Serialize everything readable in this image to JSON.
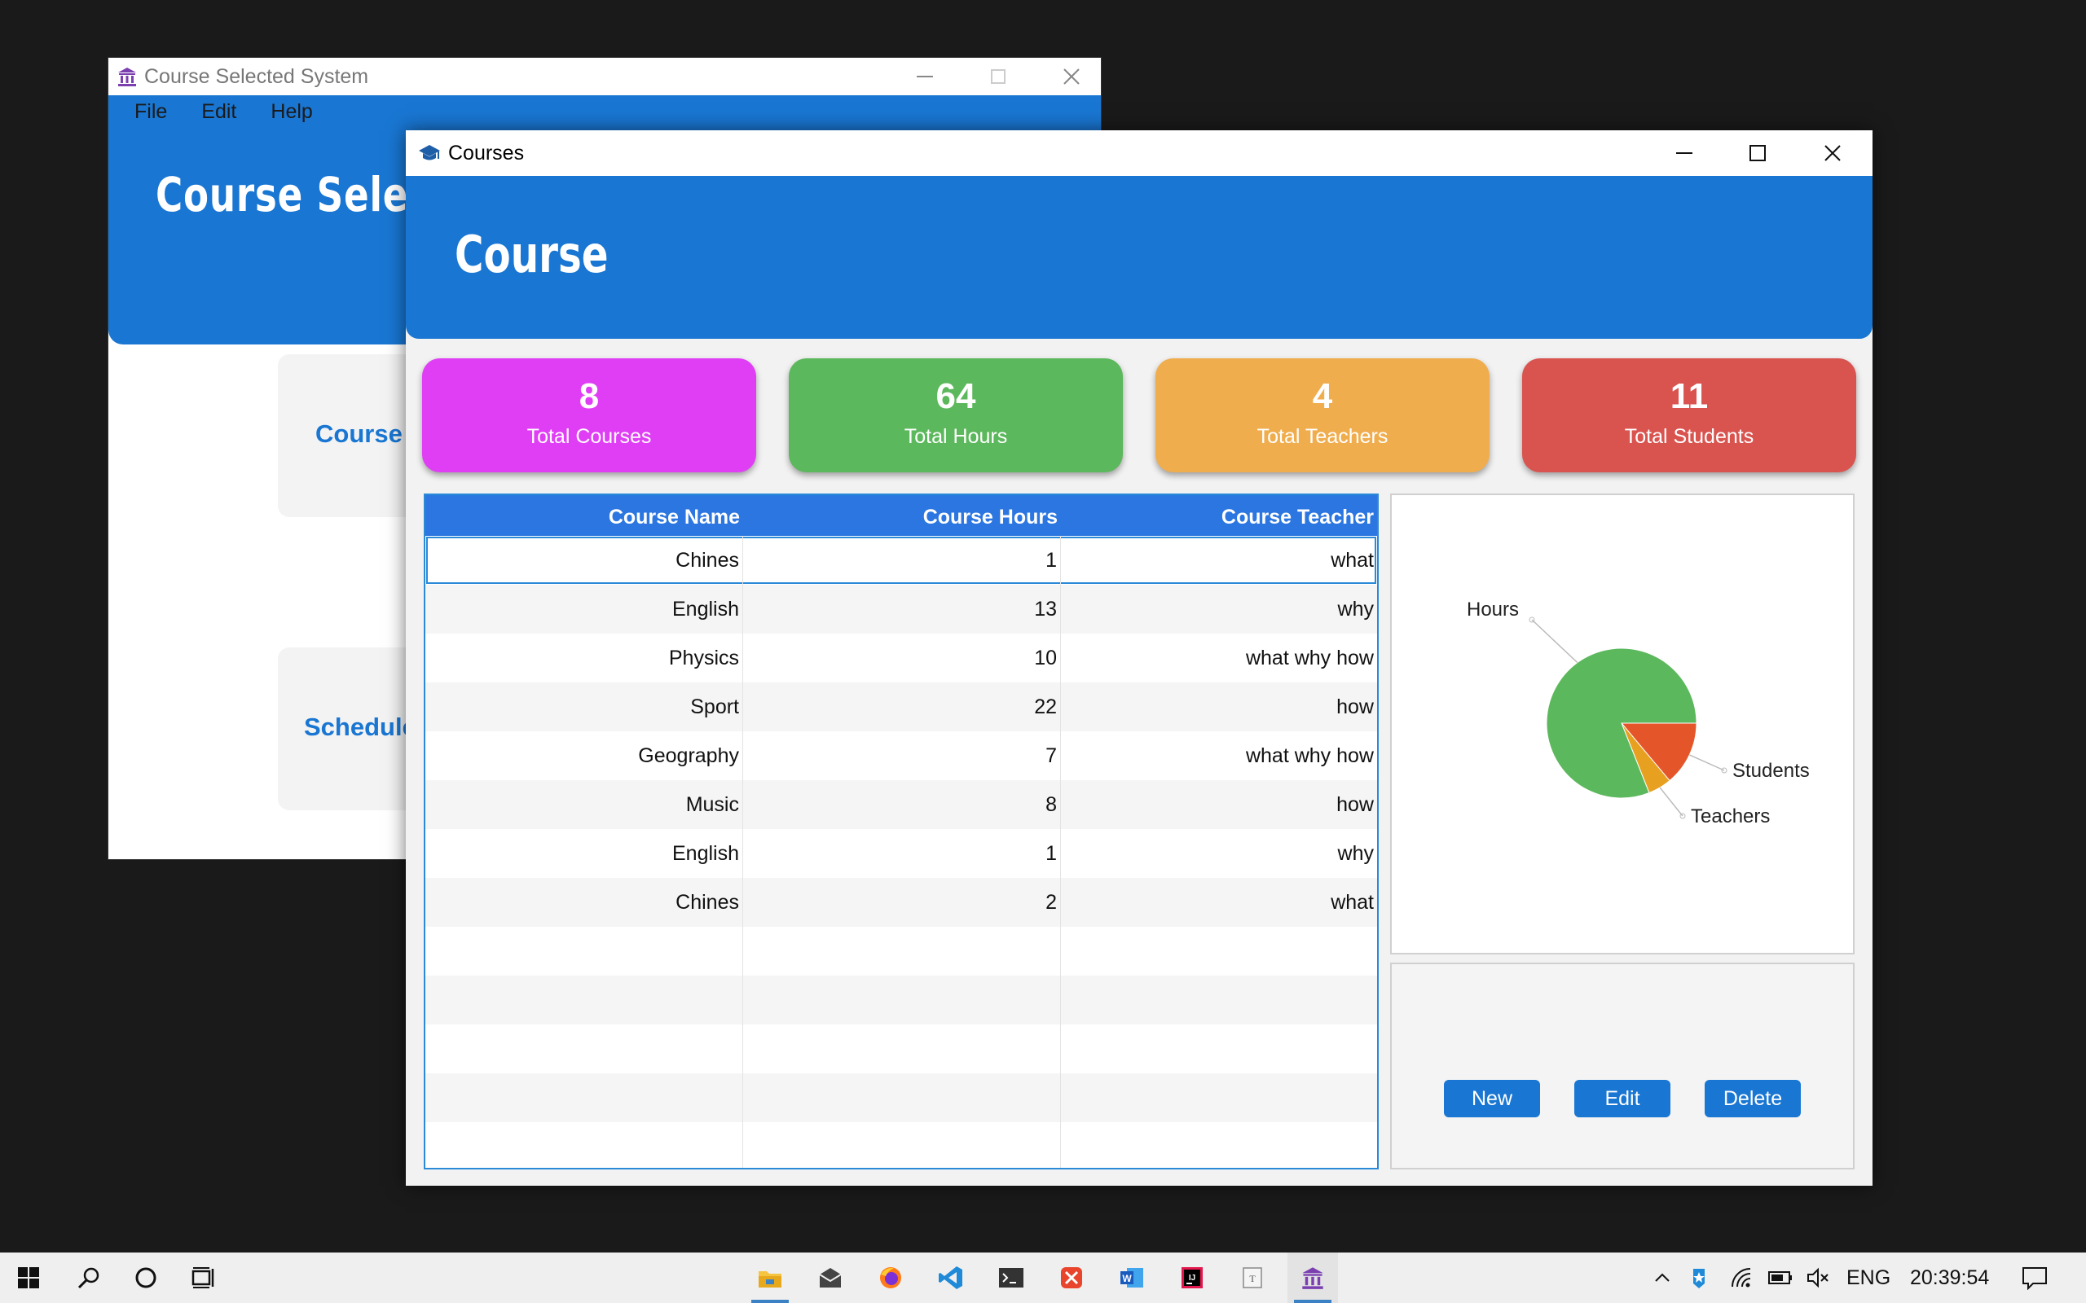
{
  "bg_window": {
    "title": "Course Selected System",
    "menu": [
      "File",
      "Edit",
      "Help"
    ],
    "header_title": "Course Selecte",
    "tiles": [
      "Course",
      "Schedule"
    ]
  },
  "fg_window": {
    "title": "Courses",
    "header_title": "Course"
  },
  "stats": [
    {
      "value": "8",
      "label": "Total Courses",
      "color": "#e03ef5"
    },
    {
      "value": "64",
      "label": "Total Hours",
      "color": "#5cb85c"
    },
    {
      "value": "4",
      "label": "Total Teachers",
      "color": "#f0ad4e"
    },
    {
      "value": "11",
      "label": "Total Students",
      "color": "#d9534f"
    }
  ],
  "table": {
    "headers": [
      "Course Name",
      "Course Hours",
      "Course Teacher"
    ],
    "rows": [
      [
        "Chines",
        "1",
        "what"
      ],
      [
        "English",
        "13",
        "why"
      ],
      [
        "Physics",
        "10",
        "what why how"
      ],
      [
        "Sport",
        "22",
        "how"
      ],
      [
        "Geography",
        "7",
        "what why how"
      ],
      [
        "Music",
        "8",
        "how"
      ],
      [
        "English",
        "1",
        "why"
      ],
      [
        "Chines",
        "2",
        "what"
      ]
    ]
  },
  "chart_data": {
    "type": "pie",
    "labels": [
      "Hours",
      "Students",
      "Teachers"
    ],
    "values": [
      64,
      11,
      4
    ],
    "colors": [
      "#5cb85c",
      "#e4562a",
      "#e8a020"
    ]
  },
  "buttons": {
    "new": "New",
    "edit": "Edit",
    "delete": "Delete"
  },
  "taskbar": {
    "apps": [
      "file-explorer-icon",
      "mail-icon",
      "firefox-icon",
      "vscode-icon",
      "terminal-icon",
      "xmind-icon",
      "word-icon",
      "intellij-icon",
      "typora-icon",
      "course-app-icon"
    ],
    "language": "ENG",
    "time": "20:39:54"
  }
}
